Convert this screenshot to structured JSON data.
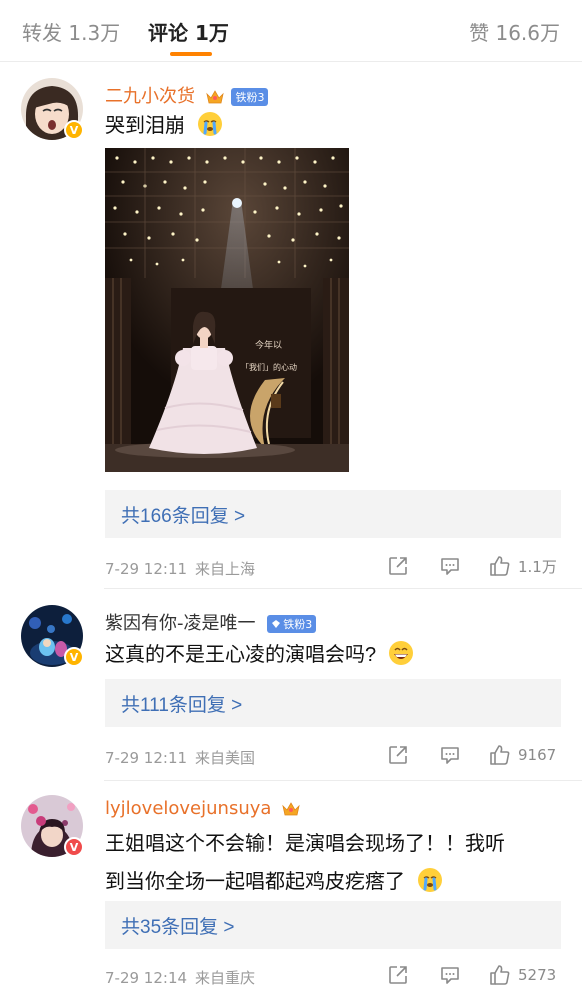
{
  "tabs": {
    "repost": "转发 1.3万",
    "comments": "评论 1万",
    "likes": "赞 16.6万"
  },
  "comments": [
    {
      "username": "二九小次货",
      "fan_badge": "铁粉3",
      "text": "哭到泪崩",
      "emoji": "crying-face-emoji",
      "photo_caption_1": "今年以",
      "photo_caption_2": "「我们」的心动",
      "replies": "共166条回复 >",
      "time": "7-29 12:11",
      "location": "来自上海",
      "likes": "1.1万"
    },
    {
      "username": "紫因有你-凌是唯一",
      "fan_badge": "铁粉3",
      "text": "这真的不是王心凌的演唱会吗?",
      "emoji": "grinning-face-emoji",
      "replies": "共111条回复 >",
      "time": "7-29 12:11",
      "location": "来自美国",
      "likes": "9167"
    },
    {
      "username": "lyjlovelovejunsuya",
      "text_line1": "王姐唱这个不会输！是演唱会现场了！！我听",
      "text_line2": "到当你全场一起唱都起鸡皮疙瘩了",
      "emoji": "crying-face-emoji",
      "replies": "共35条回复 >",
      "time": "7-29 12:14",
      "location": "来自重庆",
      "likes": "5273"
    }
  ],
  "colors": {
    "accent": "#ff8200",
    "username_highlight": "#e8712a",
    "link_blue": "#3f6fb5",
    "fan_badge": "#5a8ee6"
  }
}
